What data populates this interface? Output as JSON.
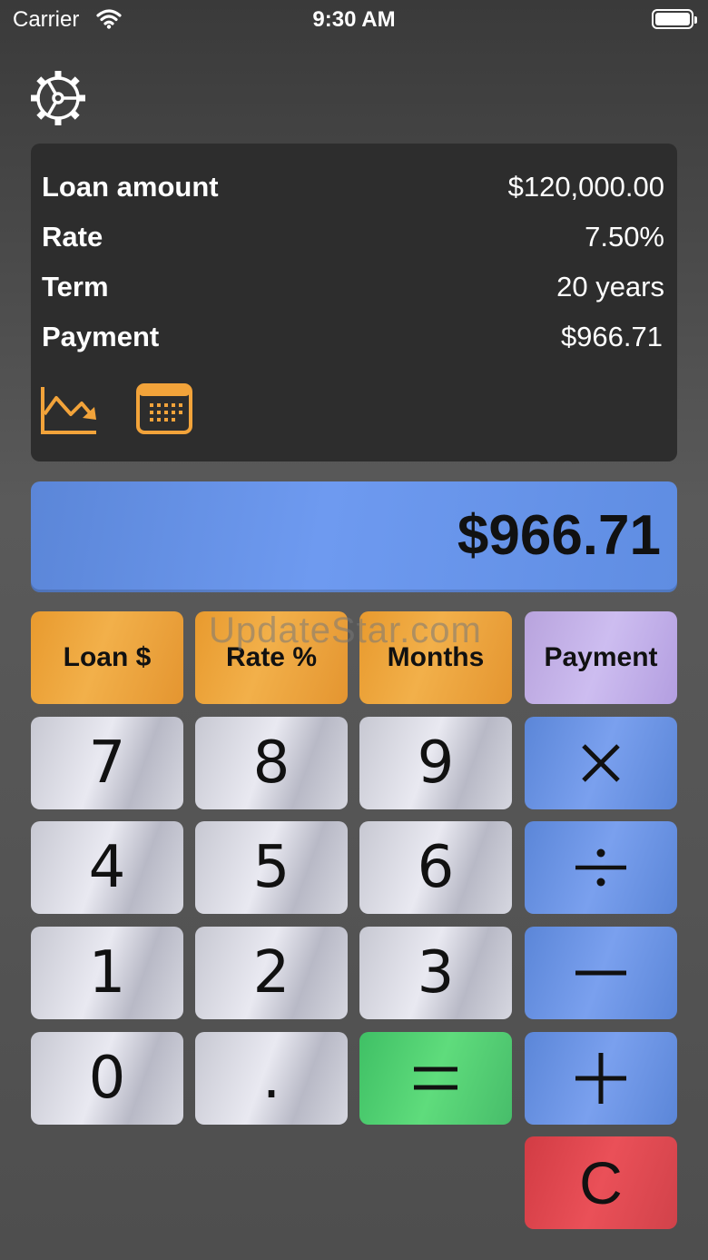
{
  "status_bar": {
    "carrier": "Carrier",
    "time": "9:30 AM"
  },
  "summary": {
    "rows": [
      {
        "label": "Loan amount",
        "value": "$120,000.00"
      },
      {
        "label": "Rate",
        "value": "7.50%"
      },
      {
        "label": "Term",
        "value": "20 years"
      },
      {
        "label": "Payment",
        "value": "$966.71"
      }
    ],
    "icons": [
      "chart-down-icon",
      "calendar-icon"
    ]
  },
  "display": {
    "value": "$966.71"
  },
  "keypad": {
    "loan": "Loan $",
    "rate": "Rate %",
    "months": "Months",
    "payment": "Payment",
    "k7": "7",
    "k8": "8",
    "k9": "9",
    "k4": "4",
    "k5": "5",
    "k6": "6",
    "k1": "1",
    "k2": "2",
    "k3": "3",
    "k0": "0",
    "dot": ".",
    "clear": "C"
  },
  "watermark": "UpdateStar.com",
  "colors": {
    "accent_orange": "#f2a33a",
    "display_blue": "#6b96ea",
    "equals_green": "#52d070",
    "clear_red": "#e04850"
  }
}
